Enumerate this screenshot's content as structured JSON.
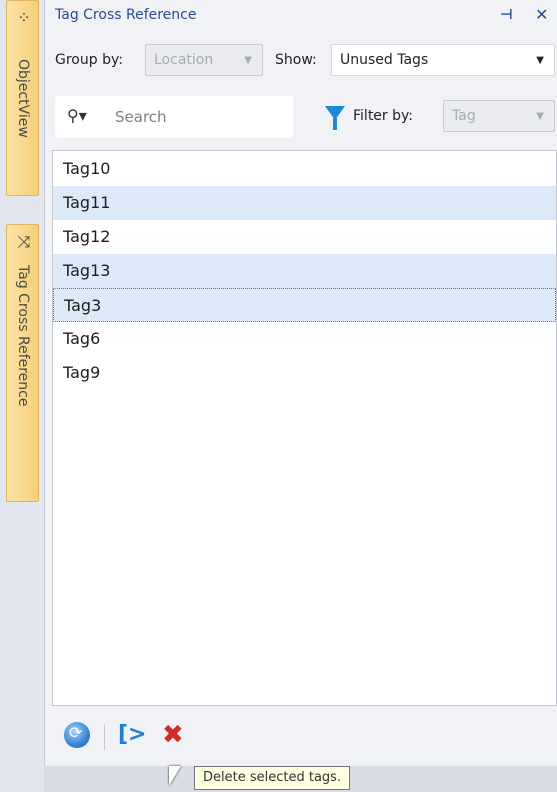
{
  "dock": {
    "tabs": [
      {
        "label": "ObjectView",
        "icon": "object-view-icon"
      },
      {
        "label": "Tag Cross Reference",
        "icon": "cross-reference-icon"
      }
    ]
  },
  "panel": {
    "title": "Tag Cross Reference",
    "pin_icon": "pin-icon",
    "close_icon": "close-icon",
    "group_by_label": "Group by:",
    "group_by_value": "Location",
    "show_label": "Show:",
    "show_value": "Unused Tags",
    "search_placeholder": "Search",
    "filter_label": "Filter by:",
    "filter_value": "Tag"
  },
  "list": {
    "items": [
      {
        "label": "Tag10",
        "state": "normal"
      },
      {
        "label": "Tag11",
        "state": "selected"
      },
      {
        "label": "Tag12",
        "state": "normal"
      },
      {
        "label": "Tag13",
        "state": "selected"
      },
      {
        "label": "Tag3",
        "state": "focused-selected"
      },
      {
        "label": "Tag6",
        "state": "normal"
      },
      {
        "label": "Tag9",
        "state": "normal"
      }
    ]
  },
  "toolbar": {
    "refresh_icon": "refresh-icon",
    "export_icon": "export-icon",
    "delete_icon": "delete-icon"
  },
  "tooltip": {
    "text": "Delete selected tags."
  },
  "colors": {
    "accent": "#2b4d8c",
    "selection": "#dbe9f8",
    "dock_tab": "#f6cf78",
    "delete": "#d32a2a",
    "filter": "#1f88d6"
  }
}
